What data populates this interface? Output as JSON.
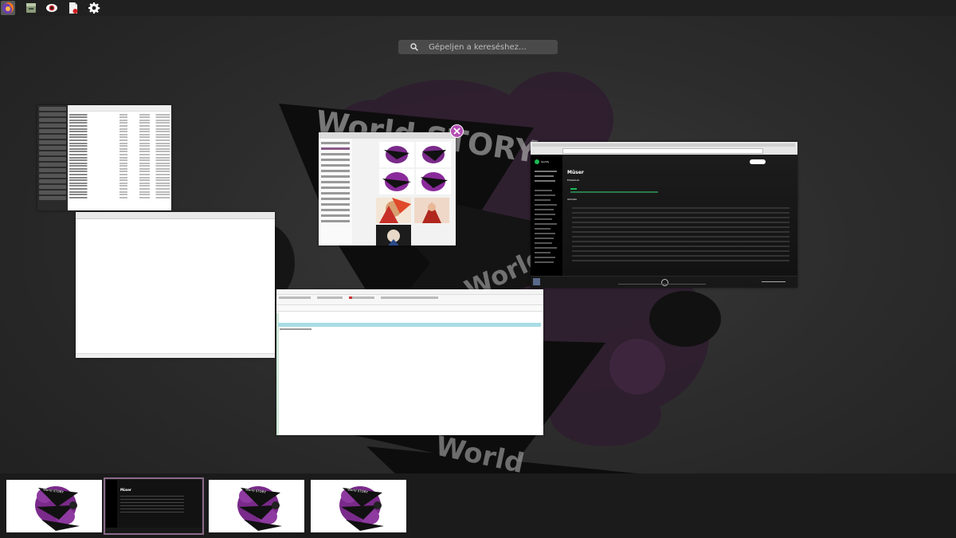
{
  "top_dock": {
    "apps": [
      {
        "icon": "firefox-icon",
        "active": true
      },
      {
        "icon": "archive-manager-icon",
        "active": false
      },
      {
        "icon": "eye-viewer-icon",
        "active": false
      },
      {
        "icon": "document-viewer-icon",
        "active": false
      },
      {
        "icon": "gear-icon",
        "active": false
      }
    ]
  },
  "search": {
    "placeholder": "Gépeljen a kereséshez…"
  },
  "background_text": [
    "World STORY",
    "World",
    "World"
  ],
  "windows": {
    "spotify": {
      "app_name": "Spotify",
      "heading": "Müser",
      "subheading": "Előadások",
      "section": "Aktuális"
    }
  },
  "workspaces": [
    {
      "active": false,
      "label": "World STORY"
    },
    {
      "active": true,
      "label": "Müser"
    },
    {
      "active": false,
      "label": "World STORY"
    },
    {
      "active": false,
      "label": "World STORY"
    }
  ],
  "colors": {
    "accent": "#b44cb4",
    "background": "#2c2c2c",
    "dock": "#202020",
    "active_outline": "#8a6a8a"
  }
}
